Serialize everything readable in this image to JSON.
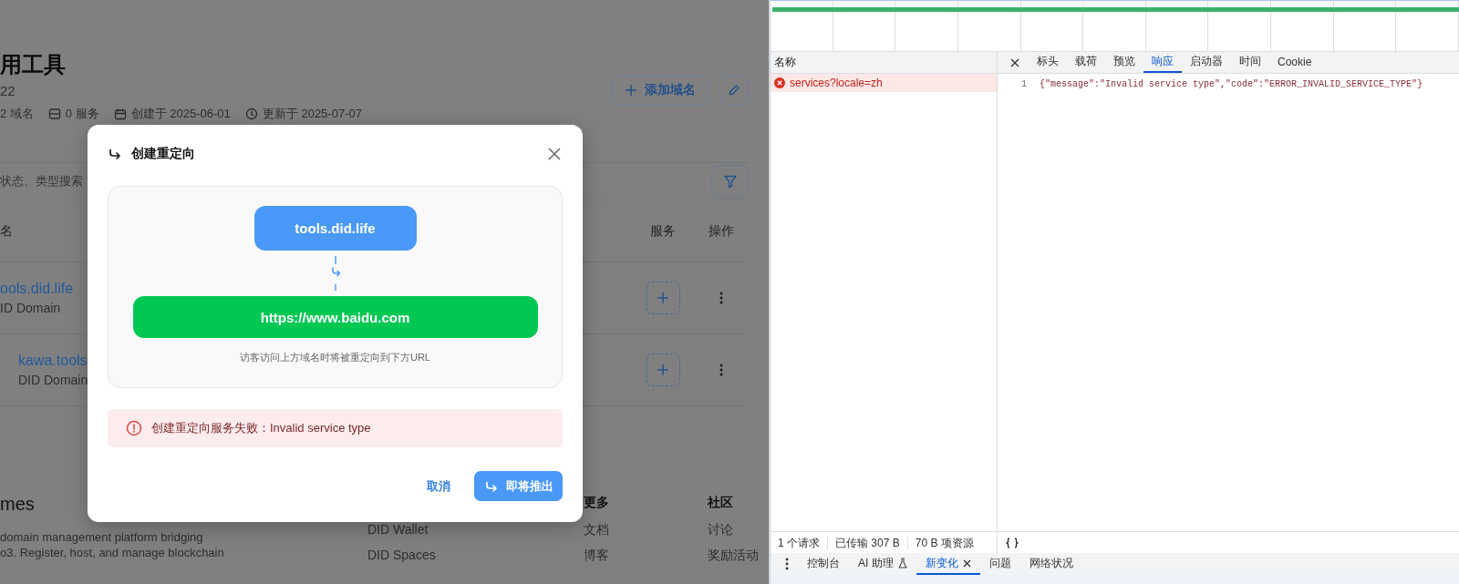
{
  "page": {
    "title": "用工具",
    "subtitle": "22",
    "meta": [
      {
        "kind": "domains",
        "text": "2 域名"
      },
      {
        "kind": "services",
        "text": "0 服务"
      },
      {
        "kind": "created",
        "text": "创建于 2025-06-01"
      },
      {
        "kind": "updated",
        "text": "更新于 2025-07-07"
      }
    ],
    "add_domain_button": "添加域名",
    "search": {
      "placeholder": "状态、类型搜索"
    },
    "table": {
      "columns": [
        {
          "kind": "name",
          "label": "名"
        },
        {
          "kind": "services",
          "label": "服务"
        },
        {
          "kind": "actions",
          "label": "操作"
        }
      ],
      "rows": [
        {
          "name": "ools.did.life",
          "type": "ID Domain",
          "indented": false
        },
        {
          "name": "kawa.tools",
          "type": "DID Domain",
          "indented": true
        }
      ]
    },
    "footer": {
      "brand": "mes",
      "description": [
        "domain management platform bridging",
        "o3. Register, host, and manage blockchain"
      ],
      "columns": [
        {
          "items": [
            "DID Wallet",
            "DID Spaces"
          ]
        },
        {
          "heading": "更多",
          "items": [
            "文档",
            "博客"
          ]
        },
        {
          "heading": "社区",
          "items": [
            "讨论",
            "奖励活动"
          ]
        }
      ]
    }
  },
  "dialog": {
    "title": "创建重定向",
    "source": "tools.did.life",
    "target": "https://www.baidu.com",
    "caption": "访客访问上方域名时将被重定向到下方URL",
    "error": "创建重定向服务失败：Invalid service type",
    "buttons": [
      {
        "kind": "text",
        "label": "取消"
      },
      {
        "kind": "primary",
        "label": "即将推出"
      }
    ]
  },
  "devtools": {
    "name_column": "名称",
    "requests": [
      {
        "name": "services?locale=zh",
        "error": true
      }
    ],
    "detail_tabs": [
      {
        "label": "标头",
        "selected": false
      },
      {
        "label": "载荷",
        "selected": false
      },
      {
        "label": "预览",
        "selected": false
      },
      {
        "label": "响应",
        "selected": true
      },
      {
        "label": "启动器",
        "selected": false
      },
      {
        "label": "时间",
        "selected": false
      },
      {
        "label": "Cookie",
        "selected": false
      }
    ],
    "response_lines": [
      {
        "number": "1",
        "code": "{\"message\":\"Invalid service type\",\"code\":\"ERROR_INVALID_SERVICE_TYPE\"}"
      }
    ],
    "status": [
      "1 个请求",
      "已传输 307 B",
      "70 B 项资源"
    ],
    "drawer_tabs": [
      {
        "label": "控制台",
        "kind": "plain",
        "selected": false
      },
      {
        "label": "AI 助理",
        "kind": "experimental",
        "selected": false
      },
      {
        "label": "新变化",
        "kind": "closable",
        "selected": true
      },
      {
        "label": "问题",
        "kind": "plain",
        "selected": false
      },
      {
        "label": "网络状况",
        "kind": "plain",
        "selected": false
      }
    ]
  }
}
